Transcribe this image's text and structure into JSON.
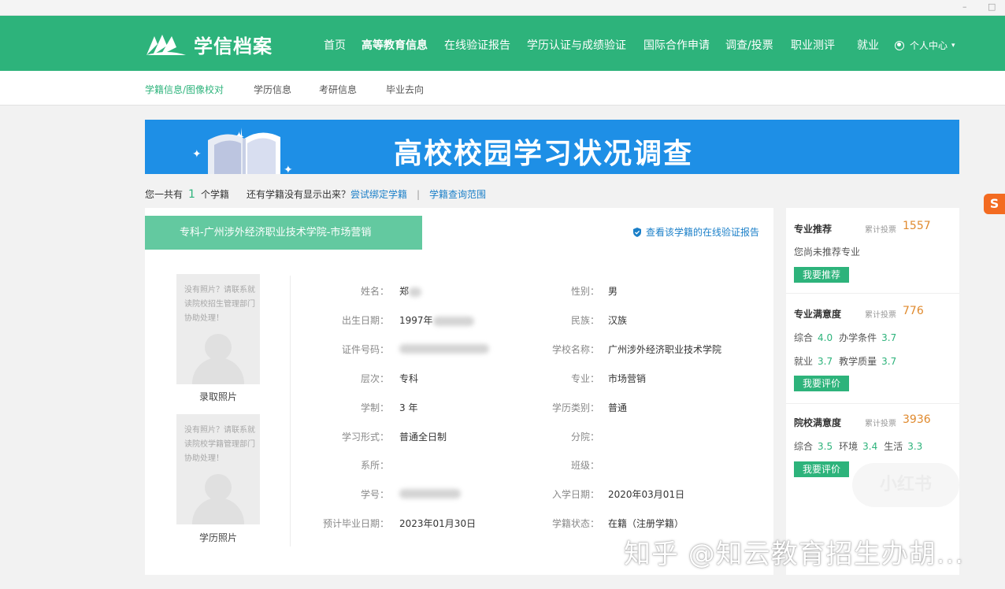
{
  "window_controls": {
    "minimize": "–",
    "maximize": "□"
  },
  "header": {
    "logo_text": "学信档案",
    "nav": [
      {
        "label": "首页"
      },
      {
        "label": "高等教育信息"
      },
      {
        "label": "在线验证报告"
      },
      {
        "label": "学历认证与成绩验证"
      },
      {
        "label": "国际合作申请"
      },
      {
        "label": "调查/投票"
      },
      {
        "label": "职业测评"
      },
      {
        "label": "就业"
      }
    ],
    "user_center": "个人中心",
    "user_caret": "▾"
  },
  "subnav": [
    {
      "label": "学籍信息/图像校对"
    },
    {
      "label": "学历信息"
    },
    {
      "label": "考研信息"
    },
    {
      "label": "毕业去向"
    }
  ],
  "banner": {
    "text": "高校校园学习状况调查"
  },
  "summary": {
    "prefix": "您一共有",
    "count": "1",
    "suffix": "个学籍",
    "missing_text": "还有学籍没有显示出来？",
    "bind_link": "尝试绑定学籍",
    "separator": "|",
    "scope_link": "学籍查询范围"
  },
  "record": {
    "title": "专科-广州涉外经济职业技术学院-市场营销",
    "verify_link": "查看该学籍的在线验证报告",
    "photo_placeholder": "没有照片？请联系就读院校招生管理部门协助处理！",
    "photo_placeholder_2": "没有照片？请联系就读院校学籍管理部门协助处理！",
    "photo_label_admission": "录取照片",
    "photo_label_degree": "学历照片",
    "left": [
      {
        "label": "姓名：",
        "value": "郑"
      },
      {
        "label": "出生日期：",
        "value": "1997年"
      },
      {
        "label": "证件号码：",
        "value": ""
      },
      {
        "label": "层次：",
        "value": "专科"
      },
      {
        "label": "学制：",
        "value": "3 年"
      },
      {
        "label": "学习形式：",
        "value": "普通全日制"
      },
      {
        "label": "系所：",
        "value": ""
      },
      {
        "label": "学号：",
        "value": ""
      },
      {
        "label": "预计毕业日期：",
        "value": "2023年01月30日"
      }
    ],
    "right": [
      {
        "label": "性别：",
        "value": "男"
      },
      {
        "label": "民族：",
        "value": "汉族"
      },
      {
        "label": "学校名称：",
        "value": "广州涉外经济职业技术学院"
      },
      {
        "label": "专业：",
        "value": "市场营销"
      },
      {
        "label": "学历类别：",
        "value": "普通"
      },
      {
        "label": "分院：",
        "value": ""
      },
      {
        "label": "班级：",
        "value": ""
      },
      {
        "label": "入学日期：",
        "value": "2020年03月01日"
      },
      {
        "label": "学籍状态：",
        "value": "在籍（注册学籍）"
      }
    ]
  },
  "sidebar": {
    "recommend": {
      "title": "专业推荐",
      "votes_label": "累计投票",
      "votes": "1557",
      "text": "您尚未推荐专业",
      "button": "我要推荐"
    },
    "major_satisfaction": {
      "title": "专业满意度",
      "votes_label": "累计投票",
      "votes": "776",
      "row1": [
        {
          "name": "综合",
          "score": "4.0"
        },
        {
          "name": "办学条件",
          "score": "3.7"
        }
      ],
      "row2": [
        {
          "name": "就业",
          "score": "3.7"
        },
        {
          "name": "教学质量",
          "score": "3.7"
        }
      ],
      "button": "我要评价"
    },
    "school_satisfaction": {
      "title": "院校满意度",
      "votes_label": "累计投票",
      "votes": "3936",
      "row1": [
        {
          "name": "综合",
          "score": "3.5"
        },
        {
          "name": "环境",
          "score": "3.4"
        },
        {
          "name": "生活",
          "score": "3.3"
        }
      ],
      "button": "我要评价"
    }
  },
  "watermarks": {
    "zhihu": "知乎 @知云教育招生办胡...",
    "xiaohongshu": "小红书",
    "sogou": "S"
  },
  "colors": {
    "brand_green": "#2db37b",
    "banner_blue": "#1e8fe6",
    "title_green": "#63c9a0",
    "link_blue": "#1a7fc8",
    "vote_orange": "#e08a2e"
  }
}
